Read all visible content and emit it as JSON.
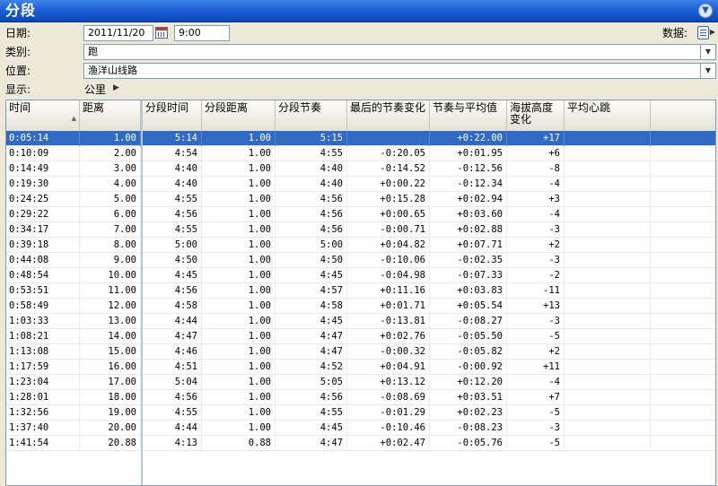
{
  "panel": {
    "title": "分段"
  },
  "form": {
    "date_label": "日期:",
    "date_value": "2011/11/20",
    "time_value": "9:00",
    "data_label": "数据:",
    "category_label": "类别:",
    "category_value": "跑",
    "location_label": "位置:",
    "location_value": "渔洋山线路",
    "display_label": "显示:",
    "display_value": "公里"
  },
  "table": {
    "columns": [
      "时间",
      "距离",
      "分段时间",
      "分段距离",
      "分段节奏",
      "最后的节奏变化",
      "节奏与平均值",
      "海拔高度变化",
      "平均心跳"
    ],
    "rows": [
      [
        "0:05:14",
        "1.00",
        "5:14",
        "1.00",
        "5:15",
        "",
        "+0:22.00",
        "+17",
        ""
      ],
      [
        "0:10:09",
        "2.00",
        "4:54",
        "1.00",
        "4:55",
        "-0:20.05",
        "+0:01.95",
        "+6",
        ""
      ],
      [
        "0:14:49",
        "3.00",
        "4:40",
        "1.00",
        "4:40",
        "-0:14.52",
        "-0:12.56",
        "-8",
        ""
      ],
      [
        "0:19:30",
        "4.00",
        "4:40",
        "1.00",
        "4:40",
        "+0:00.22",
        "-0:12.34",
        "-4",
        ""
      ],
      [
        "0:24:25",
        "5.00",
        "4:55",
        "1.00",
        "4:56",
        "+0:15.28",
        "+0:02.94",
        "+3",
        ""
      ],
      [
        "0:29:22",
        "6.00",
        "4:56",
        "1.00",
        "4:56",
        "+0:00.65",
        "+0:03.60",
        "-4",
        ""
      ],
      [
        "0:34:17",
        "7.00",
        "4:55",
        "1.00",
        "4:56",
        "-0:00.71",
        "+0:02.88",
        "-3",
        ""
      ],
      [
        "0:39:18",
        "8.00",
        "5:00",
        "1.00",
        "5:00",
        "+0:04.82",
        "+0:07.71",
        "+2",
        ""
      ],
      [
        "0:44:08",
        "9.00",
        "4:50",
        "1.00",
        "4:50",
        "-0:10.06",
        "-0:02.35",
        "-3",
        ""
      ],
      [
        "0:48:54",
        "10.00",
        "4:45",
        "1.00",
        "4:45",
        "-0:04.98",
        "-0:07.33",
        "-2",
        ""
      ],
      [
        "0:53:51",
        "11.00",
        "4:56",
        "1.00",
        "4:57",
        "+0:11.16",
        "+0:03.83",
        "-11",
        ""
      ],
      [
        "0:58:49",
        "12.00",
        "4:58",
        "1.00",
        "4:58",
        "+0:01.71",
        "+0:05.54",
        "+13",
        ""
      ],
      [
        "1:03:33",
        "13.00",
        "4:44",
        "1.00",
        "4:45",
        "-0:13.81",
        "-0:08.27",
        "-3",
        ""
      ],
      [
        "1:08:21",
        "14.00",
        "4:47",
        "1.00",
        "4:47",
        "+0:02.76",
        "-0:05.50",
        "-5",
        ""
      ],
      [
        "1:13:08",
        "15.00",
        "4:46",
        "1.00",
        "4:47",
        "-0:00.32",
        "-0:05.82",
        "+2",
        ""
      ],
      [
        "1:17:59",
        "16.00",
        "4:51",
        "1.00",
        "4:52",
        "+0:04.91",
        "-0:00.92",
        "+11",
        ""
      ],
      [
        "1:23:04",
        "17.00",
        "5:04",
        "1.00",
        "5:05",
        "+0:13.12",
        "+0:12.20",
        "-4",
        ""
      ],
      [
        "1:28:01",
        "18.00",
        "4:56",
        "1.00",
        "4:56",
        "-0:08.69",
        "+0:03.51",
        "+7",
        ""
      ],
      [
        "1:32:56",
        "19.00",
        "4:55",
        "1.00",
        "4:55",
        "-0:01.29",
        "+0:02.23",
        "-5",
        ""
      ],
      [
        "1:37:40",
        "20.00",
        "4:44",
        "1.00",
        "4:45",
        "-0:10.46",
        "-0:08.23",
        "-3",
        ""
      ],
      [
        "1:41:54",
        "20.88",
        "4:13",
        "0.88",
        "4:47",
        "+0:02.47",
        "-0:05.76",
        "-5",
        ""
      ]
    ]
  },
  "colors": {
    "title_bar": "#1e5fd6",
    "selection": "#316ac5",
    "window_bg": "#ece9d8"
  },
  "icons": {
    "collapse": "chevron-down-circle-icon",
    "calendar": "calendar-icon",
    "data": "data-sheet-icon"
  }
}
